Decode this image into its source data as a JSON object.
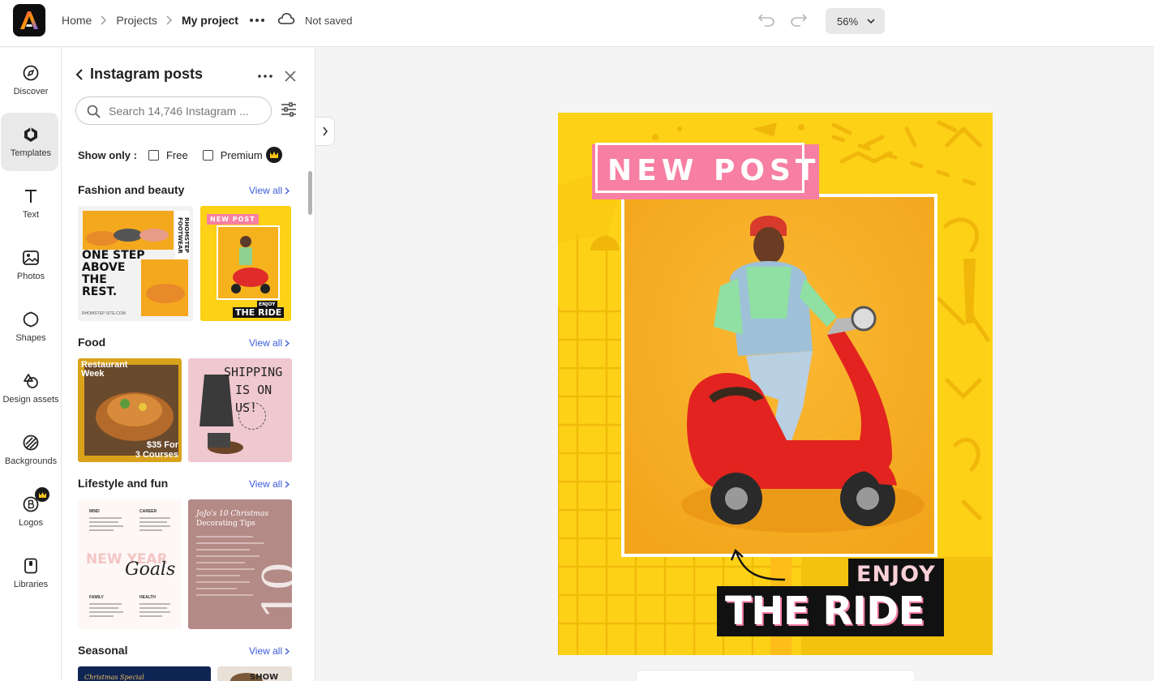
{
  "header": {
    "breadcrumb": [
      "Home",
      "Projects",
      "My project"
    ],
    "save_status": "Not saved",
    "zoom": "56%"
  },
  "rail": {
    "items": [
      {
        "label": "Discover",
        "icon": "compass-icon"
      },
      {
        "label": "Templates",
        "icon": "templates-icon",
        "active": true
      },
      {
        "label": "Text",
        "icon": "text-icon"
      },
      {
        "label": "Photos",
        "icon": "photo-icon"
      },
      {
        "label": "Shapes",
        "icon": "shapes-icon"
      },
      {
        "label": "Design assets",
        "icon": "design-assets-icon"
      },
      {
        "label": "Backgrounds",
        "icon": "backgrounds-icon"
      },
      {
        "label": "Logos",
        "icon": "logos-icon",
        "premium": true
      },
      {
        "label": "Libraries",
        "icon": "libraries-icon"
      }
    ]
  },
  "panel": {
    "title": "Instagram posts",
    "search_placeholder": "Search 14,746 Instagram ...",
    "show_only_label": "Show only :",
    "filters": [
      "Free",
      "Premium"
    ],
    "view_all_label": "View all",
    "sections": [
      {
        "title": "Fashion and beauty"
      },
      {
        "title": "Food"
      },
      {
        "title": "Lifestyle and fun"
      },
      {
        "title": "Seasonal"
      }
    ],
    "thumbs": {
      "fashion1": {
        "title_lines": [
          "ONE STEP",
          "ABOVE",
          "THE",
          "REST."
        ],
        "vertical": "RHOMSTEP FOOTWEAR",
        "site": "RHOMSTEP SITE.COM"
      },
      "fashion2": {
        "badge": "NEW POST",
        "enjoy": "ENJOY",
        "ride": "THE RIDE"
      },
      "food1": {
        "title_lines": [
          "Restaurant",
          "Week"
        ],
        "price_lines": [
          "$35 For",
          "3 Courses"
        ]
      },
      "food2": {
        "title_lines": [
          "SHIPPING",
          "IS ON US!"
        ]
      },
      "life1": {
        "headers": [
          "MIND",
          "CAREER",
          "FAMILY",
          "HEALTH"
        ],
        "big": "NEW YEAR",
        "script": "Goals"
      },
      "life2": {
        "title_lines": [
          "JoJo's 10 Christmas",
          "Decorating Tips"
        ],
        "number": "10"
      },
      "seasonal1": {
        "title": "Christmas Special"
      },
      "seasonal2": {
        "title": "SHOW"
      }
    }
  },
  "artboard": {
    "badge": "NEW POST",
    "enjoy": "ENJOY",
    "ride": "THE RIDE"
  },
  "colors": {
    "accent_yellow": "#fcd116",
    "pink": "#f77fa3",
    "link_blue": "#3b5bdb"
  }
}
